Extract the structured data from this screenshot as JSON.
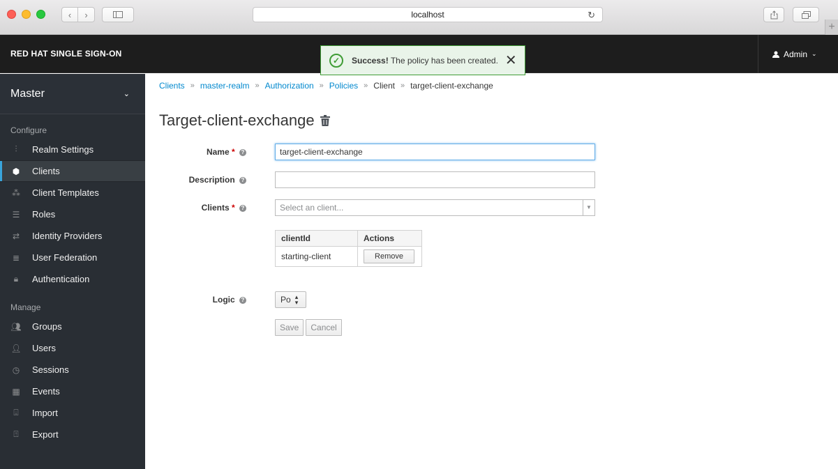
{
  "browser": {
    "url": "localhost"
  },
  "app": {
    "brand": "RED HAT SINGLE SIGN-ON",
    "user": "Admin"
  },
  "toast": {
    "strong": "Success!",
    "message": " The policy has been created."
  },
  "sidebar": {
    "realm": "Master",
    "configure_label": "Configure",
    "manage_label": "Manage",
    "configure_items": [
      {
        "label": "Realm Settings",
        "icon": "sliders-icon"
      },
      {
        "label": "Clients",
        "icon": "cube-icon"
      },
      {
        "label": "Client Templates",
        "icon": "cubes-icon"
      },
      {
        "label": "Roles",
        "icon": "list-icon"
      },
      {
        "label": "Identity Providers",
        "icon": "exchange-icon"
      },
      {
        "label": "User Federation",
        "icon": "database-icon"
      },
      {
        "label": "Authentication",
        "icon": "lock-icon"
      }
    ],
    "manage_items": [
      {
        "label": "Groups",
        "icon": "users-icon"
      },
      {
        "label": "Users",
        "icon": "user-icon"
      },
      {
        "label": "Sessions",
        "icon": "clock-icon"
      },
      {
        "label": "Events",
        "icon": "calendar-icon"
      },
      {
        "label": "Import",
        "icon": "import-icon"
      },
      {
        "label": "Export",
        "icon": "export-icon"
      }
    ]
  },
  "breadcrumb": [
    "Clients",
    "master-realm",
    "Authorization",
    "Policies",
    "Client",
    "target-client-exchange"
  ],
  "page": {
    "title": "Target-client-exchange"
  },
  "form": {
    "name_label": "Name",
    "name_value": "target-client-exchange",
    "description_label": "Description",
    "description_value": "",
    "clients_label": "Clients",
    "clients_placeholder": "Select an client...",
    "table_headers": [
      "clientId",
      "Actions"
    ],
    "table_rows": [
      {
        "clientId": "starting-client",
        "action": "Remove"
      }
    ],
    "logic_label": "Logic",
    "logic_value": "Po",
    "save_label": "Save",
    "cancel_label": "Cancel"
  }
}
